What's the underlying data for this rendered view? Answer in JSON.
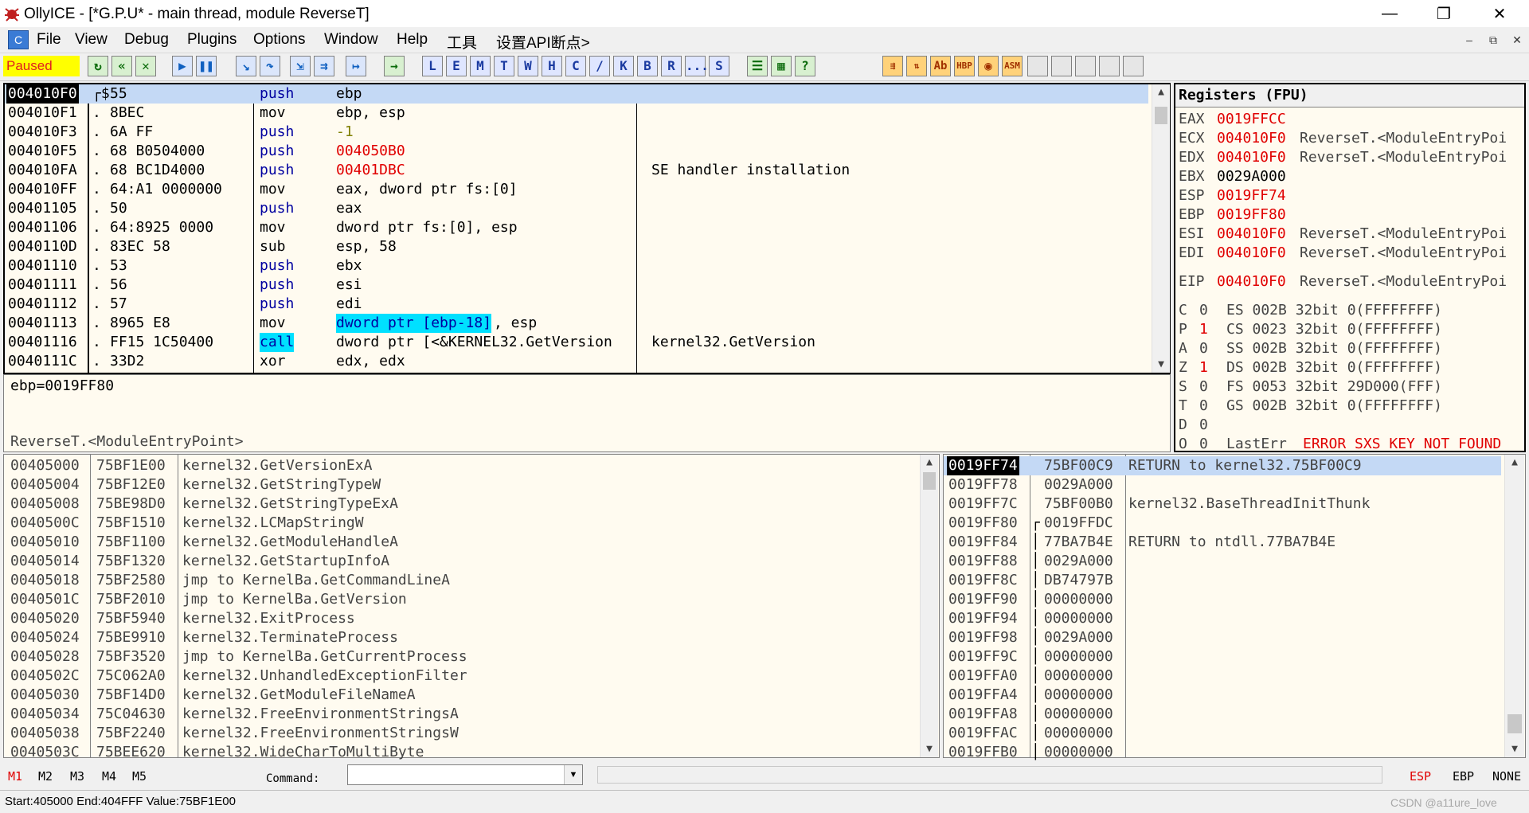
{
  "window": {
    "title": "OllyICE - [*G.P.U* - main thread, module ReverseT]",
    "minimize": "—",
    "restore": "❐",
    "close": "✕"
  },
  "menu": {
    "items": [
      "File",
      "View",
      "Debug",
      "Plugins",
      "Options",
      "Window",
      "Help",
      "工具",
      "设置API断点>"
    ],
    "mdi_min": "–",
    "mdi_restore": "⧉",
    "mdi_close": "✕"
  },
  "toolbar": {
    "status": "Paused",
    "letters": [
      "L",
      "E",
      "M",
      "T",
      "W",
      "H",
      "C",
      "/",
      "K",
      "B",
      "R",
      "...",
      "S"
    ],
    "right_labels": [
      "HBP",
      "ASM"
    ]
  },
  "colors": {
    "paused_bg": "#ffff00",
    "paused_text": "#e02020",
    "selection": "#c4d9f5",
    "highlight_cyan": "#00e0ff",
    "changed_red": "#e00000",
    "panel_bg": "#fffbf0"
  },
  "cpu": {
    "rows": [
      {
        "addr": "004010F0",
        "mark": "┌$",
        "hex": "55",
        "mnem": "push",
        "ops": "ebp",
        "comment": ""
      },
      {
        "addr": "004010F1",
        "mark": ".",
        "hex": "8BEC",
        "mnem": "mov",
        "ops": "ebp, esp",
        "comment": ""
      },
      {
        "addr": "004010F3",
        "mark": ".",
        "hex": "6A FF",
        "mnem": "push",
        "ops": "-1",
        "comment": ""
      },
      {
        "addr": "004010F5",
        "mark": ".",
        "hex": "68 B0504000",
        "mnem": "push",
        "ops": "004050B0",
        "comment": ""
      },
      {
        "addr": "004010FA",
        "mark": ".",
        "hex": "68 BC1D4000",
        "mnem": "push",
        "ops": "00401DBC",
        "comment": "SE handler installation"
      },
      {
        "addr": "004010FF",
        "mark": ".",
        "hex": "64:A1 0000000",
        "mnem": "mov",
        "ops": "eax, dword ptr fs:[0]",
        "comment": ""
      },
      {
        "addr": "00401105",
        "mark": ".",
        "hex": "50",
        "mnem": "push",
        "ops": "eax",
        "comment": ""
      },
      {
        "addr": "00401106",
        "mark": ".",
        "hex": "64:8925 0000",
        "mnem": "mov",
        "ops": "dword ptr fs:[0], esp",
        "comment": ""
      },
      {
        "addr": "0040110D",
        "mark": ".",
        "hex": "83EC 58",
        "mnem": "sub",
        "ops": "esp, 58",
        "comment": ""
      },
      {
        "addr": "00401110",
        "mark": ".",
        "hex": "53",
        "mnem": "push",
        "ops": "ebx",
        "comment": ""
      },
      {
        "addr": "00401111",
        "mark": ".",
        "hex": "56",
        "mnem": "push",
        "ops": "esi",
        "comment": ""
      },
      {
        "addr": "00401112",
        "mark": ".",
        "hex": "57",
        "mnem": "push",
        "ops": "edi",
        "comment": ""
      },
      {
        "addr": "00401113",
        "mark": ".",
        "hex": "8965 E8",
        "mnem": "mov",
        "ops": "dword ptr [ebp-18]",
        "ops2": ", esp",
        "comment": ""
      },
      {
        "addr": "00401116",
        "mark": ".",
        "hex": "FF15 1C50400",
        "mnem": "call",
        "ops": "dword ptr [<&KERNEL32.GetVersion",
        "comment": "kernel32.GetVersion"
      },
      {
        "addr": "0040111C",
        "mark": ".",
        "hex": "33D2",
        "mnem": "xor",
        "ops": "edx, edx",
        "comment": ""
      }
    ]
  },
  "info": {
    "line1": "ebp=0019FF80",
    "line2": "ReverseT.<ModuleEntryPoint>"
  },
  "registers": {
    "header": "Registers (FPU)",
    "gp": [
      {
        "name": "EAX",
        "value": "0019FFCC",
        "note": ""
      },
      {
        "name": "ECX",
        "value": "004010F0",
        "note": "ReverseT.<ModuleEntryPoi"
      },
      {
        "name": "EDX",
        "value": "004010F0",
        "note": "ReverseT.<ModuleEntryPoi"
      },
      {
        "name": "EBX",
        "value": "0029A000",
        "note": ""
      },
      {
        "name": "ESP",
        "value": "0019FF74",
        "note": ""
      },
      {
        "name": "EBP",
        "value": "0019FF80",
        "note": ""
      },
      {
        "name": "ESI",
        "value": "004010F0",
        "note": "ReverseT.<ModuleEntryPoi"
      },
      {
        "name": "EDI",
        "value": "004010F0",
        "note": "ReverseT.<ModuleEntryPoi"
      }
    ],
    "eip": {
      "name": "EIP",
      "value": "004010F0",
      "note": "ReverseT.<ModuleEntryPoi"
    },
    "flags": [
      {
        "f": "C",
        "v": "0",
        "seg": "ES 002B 32bit 0(FFFFFFFF)"
      },
      {
        "f": "P",
        "v": "1",
        "seg": "CS 0023 32bit 0(FFFFFFFF)"
      },
      {
        "f": "A",
        "v": "0",
        "seg": "SS 002B 32bit 0(FFFFFFFF)"
      },
      {
        "f": "Z",
        "v": "1",
        "seg": "DS 002B 32bit 0(FFFFFFFF)"
      },
      {
        "f": "S",
        "v": "0",
        "seg": "FS 0053 32bit 29D000(FFF)"
      },
      {
        "f": "T",
        "v": "0",
        "seg": "GS 002B 32bit 0(FFFFFFFF)"
      },
      {
        "f": "D",
        "v": "0",
        "seg": ""
      },
      {
        "f": "O",
        "v": "0",
        "seg": "LastErr",
        "err": "ERROR_SXS_KEY_NOT_FOUND"
      }
    ]
  },
  "dump": {
    "rows": [
      {
        "addr": "00405000",
        "val": "75BF1E00",
        "text": "kernel32.GetVersionExA"
      },
      {
        "addr": "00405004",
        "val": "75BF12E0",
        "text": "kernel32.GetStringTypeW"
      },
      {
        "addr": "00405008",
        "val": "75BE98D0",
        "text": "kernel32.GetStringTypeExA"
      },
      {
        "addr": "0040500C",
        "val": "75BF1510",
        "text": "kernel32.LCMapStringW"
      },
      {
        "addr": "00405010",
        "val": "75BF1100",
        "text": "kernel32.GetModuleHandleA"
      },
      {
        "addr": "00405014",
        "val": "75BF1320",
        "text": "kernel32.GetStartupInfoA"
      },
      {
        "addr": "00405018",
        "val": "75BF2580",
        "text": "jmp to KernelBa.GetCommandLineA"
      },
      {
        "addr": "0040501C",
        "val": "75BF2010",
        "text": "jmp to KernelBa.GetVersion"
      },
      {
        "addr": "00405020",
        "val": "75BF5940",
        "text": "kernel32.ExitProcess"
      },
      {
        "addr": "00405024",
        "val": "75BE9910",
        "text": "kernel32.TerminateProcess"
      },
      {
        "addr": "00405028",
        "val": "75BF3520",
        "text": "jmp to KernelBa.GetCurrentProcess"
      },
      {
        "addr": "0040502C",
        "val": "75C062A0",
        "text": "kernel32.UnhandledExceptionFilter"
      },
      {
        "addr": "00405030",
        "val": "75BF14D0",
        "text": "kernel32.GetModuleFileNameA"
      },
      {
        "addr": "00405034",
        "val": "75C04630",
        "text": "kernel32.FreeEnvironmentStringsA"
      },
      {
        "addr": "00405038",
        "val": "75BF2240",
        "text": "kernel32.FreeEnvironmentStringsW"
      },
      {
        "addr": "0040503C",
        "val": "75BEE620",
        "text": "kernel32.WideCharToMultiByte"
      }
    ]
  },
  "stack": {
    "rows": [
      {
        "addr": "0019FF74",
        "mark": "",
        "val": "75BF00C9",
        "text": "RETURN to kernel32.75BF00C9"
      },
      {
        "addr": "0019FF78",
        "mark": "",
        "val": "0029A000",
        "text": ""
      },
      {
        "addr": "0019FF7C",
        "mark": "",
        "val": "75BF00B0",
        "text": "kernel32.BaseThreadInitThunk"
      },
      {
        "addr": "0019FF80",
        "mark": "┌",
        "val": "0019FFDC",
        "text": ""
      },
      {
        "addr": "0019FF84",
        "mark": "│",
        "val": "77BA7B4E",
        "text": "RETURN to ntdll.77BA7B4E"
      },
      {
        "addr": "0019FF88",
        "mark": "│",
        "val": "0029A000",
        "text": ""
      },
      {
        "addr": "0019FF8C",
        "mark": "│",
        "val": "DB74797B",
        "text": ""
      },
      {
        "addr": "0019FF90",
        "mark": "│",
        "val": "00000000",
        "text": ""
      },
      {
        "addr": "0019FF94",
        "mark": "│",
        "val": "00000000",
        "text": ""
      },
      {
        "addr": "0019FF98",
        "mark": "│",
        "val": "0029A000",
        "text": ""
      },
      {
        "addr": "0019FF9C",
        "mark": "│",
        "val": "00000000",
        "text": ""
      },
      {
        "addr": "0019FFA0",
        "mark": "│",
        "val": "00000000",
        "text": ""
      },
      {
        "addr": "0019FFA4",
        "mark": "│",
        "val": "00000000",
        "text": ""
      },
      {
        "addr": "0019FFA8",
        "mark": "│",
        "val": "00000000",
        "text": ""
      },
      {
        "addr": "0019FFAC",
        "mark": "│",
        "val": "00000000",
        "text": ""
      },
      {
        "addr": "0019FFB0",
        "mark": "│",
        "val": "00000000",
        "text": ""
      }
    ]
  },
  "bottom": {
    "markers": [
      "M1",
      "M2",
      "M3",
      "M4",
      "M5"
    ],
    "command_label": "Command:",
    "command_value": "",
    "esp": "ESP",
    "ebp": "EBP",
    "none": "NONE"
  },
  "status": {
    "text": "Start:405000 End:404FFF Value:75BF1E00",
    "watermark": "CSDN @a11ure_love"
  }
}
